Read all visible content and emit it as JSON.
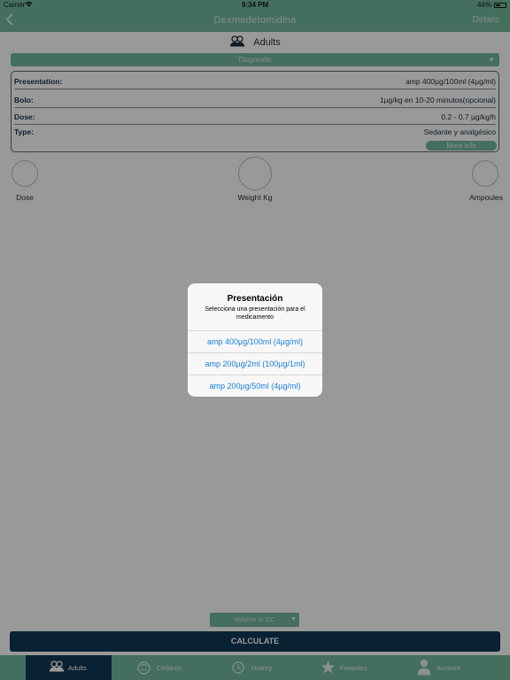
{
  "statusbar": {
    "carrier": "Carrier",
    "time": "9:34 PM",
    "battery": "44%"
  },
  "navbar": {
    "back_icon": "chevron-left-icon",
    "title": "Dexmedetomidina",
    "details": "Details"
  },
  "mode": {
    "icon": "adults-icon",
    "label": "Adults"
  },
  "diagnostic": {
    "value": "Diagnostic"
  },
  "info": {
    "rows": [
      {
        "label": "Presentation:",
        "value": "amp 400µg/100ml (4µg/ml)"
      },
      {
        "label": "Bolo:",
        "value": "1µg/kg en 10-20 minutos(opcional)"
      },
      {
        "label": "Dose:",
        "value": "0.2 - 0.7 µg/kg/h"
      },
      {
        "label": "Type:",
        "value": "Sedante y analgésico"
      }
    ],
    "more_info": "More info"
  },
  "calculator": {
    "dose": "Dose",
    "weight": "Weight Kg",
    "ampoules": "Ampoules"
  },
  "volume": {
    "value": "Volume in CC"
  },
  "calculate": "CALCULATE",
  "tabs": [
    {
      "label": "Adults",
      "icon": "adults-icon"
    },
    {
      "label": "Children",
      "icon": "children-icon"
    },
    {
      "label": "History",
      "icon": "clock-icon"
    },
    {
      "label": "Favorites",
      "icon": "star-icon"
    },
    {
      "label": "Account",
      "icon": "user-icon"
    }
  ],
  "alert": {
    "title": "Presentación",
    "message": "Selecciona una presentación para el medicamento",
    "options": [
      "amp 400µg/100ml (4µg/ml)",
      "amp 200µg/2ml (100µg/1ml)",
      "amp 200µg/50ml (4µg/ml)"
    ]
  },
  "colors": {
    "primary": "#72b89b",
    "dark": "#0f3a55",
    "link": "#1a7fe0"
  }
}
